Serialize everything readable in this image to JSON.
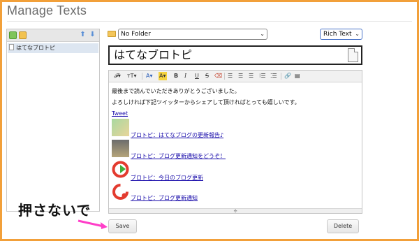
{
  "page": {
    "title": "Manage Texts"
  },
  "sidebar": {
    "items": [
      {
        "label": "はてなブロトピ"
      }
    ]
  },
  "editor": {
    "folder_select": "No Folder",
    "mode_select": "Rich Text",
    "title_value": "はてなブロトピ",
    "toolbar": {
      "items": [
        "font-family",
        "font-size",
        "text-color",
        "highlight-color",
        "bold",
        "italic",
        "underline",
        "strikethrough",
        "clear-format",
        "align-left",
        "align-center",
        "align-right",
        "ordered-list",
        "bullet-list",
        "link",
        "source"
      ],
      "labels": {
        "bold": "B",
        "italic": "I",
        "underline": "U",
        "strike": "S"
      }
    },
    "content": {
      "line1": "最後まで読んでいただきありがとうございました。",
      "line2": "よろしければ下記ツイッターからシェアして頂ければとっても嬉しいです。",
      "tweet": "Tweet",
      "links": [
        "ブロトピ：はてなブログの更新報告♪",
        "ブロトピ：ブログ更新通知をどうぞ！",
        "ブロトピ：今日のブログ更新",
        "ブロトピ：ブログ更新通知"
      ]
    }
  },
  "buttons": {
    "save": "Save",
    "delete": "Delete"
  },
  "annotation": {
    "text": "押さないで",
    "arrow_color": "#ff3ec8"
  },
  "colors": {
    "frame": "#f2a03a",
    "accent": "#4a74c8",
    "link": "#1a0dab"
  }
}
